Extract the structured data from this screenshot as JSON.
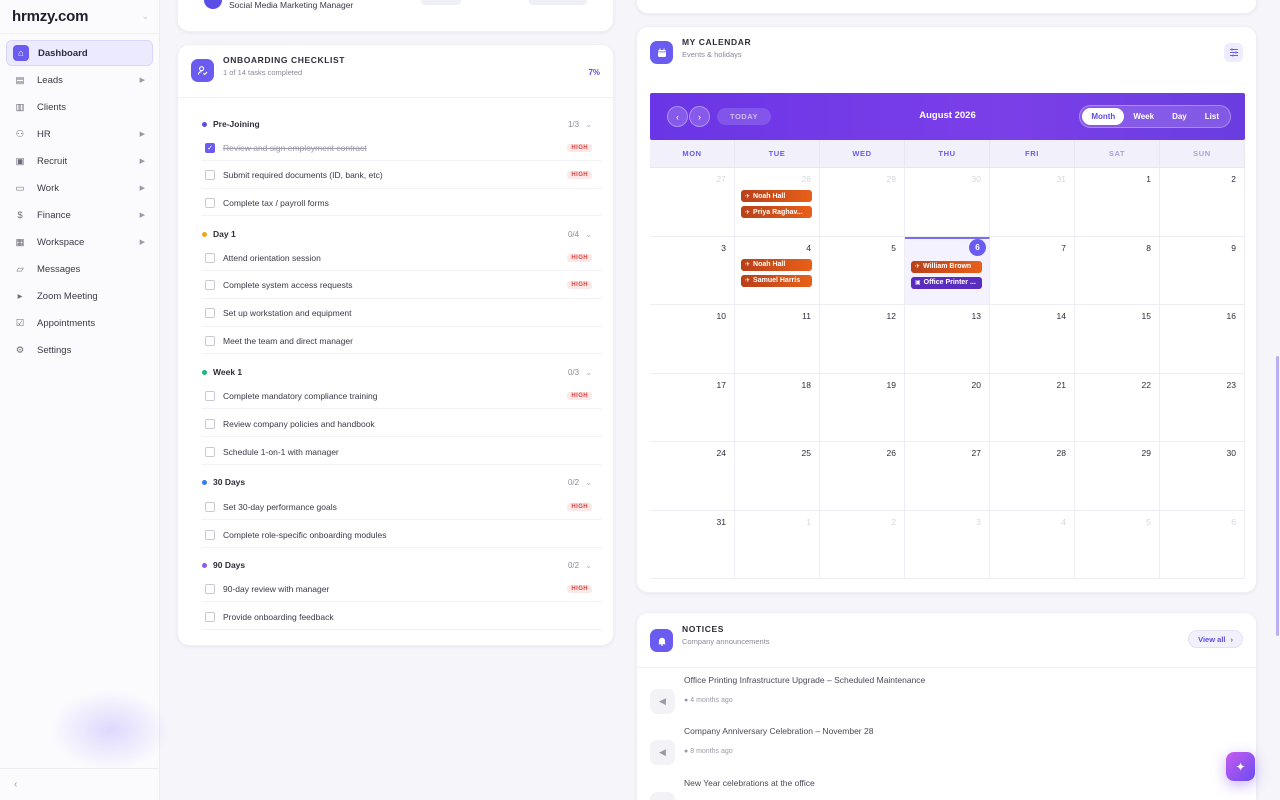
{
  "brand": {
    "logo": "hrmzy.com",
    "dot": "."
  },
  "sidebar": {
    "items": [
      {
        "label": "Dashboard",
        "icon": "home-icon",
        "active": true,
        "arrow": false
      },
      {
        "label": "Leads",
        "icon": "contact-card-icon",
        "arrow": true
      },
      {
        "label": "Clients",
        "icon": "chart-icon",
        "arrow": false
      },
      {
        "label": "HR",
        "icon": "users-icon",
        "arrow": true
      },
      {
        "label": "Recruit",
        "icon": "id-badge-icon",
        "arrow": true
      },
      {
        "label": "Work",
        "icon": "briefcase-icon",
        "arrow": true
      },
      {
        "label": "Finance",
        "icon": "dollar-icon",
        "arrow": true
      },
      {
        "label": "Workspace",
        "icon": "grid-icon",
        "arrow": true
      },
      {
        "label": "Messages",
        "icon": "message-icon",
        "arrow": false
      },
      {
        "label": "Zoom Meeting",
        "icon": "video-icon",
        "arrow": false
      },
      {
        "label": "Appointments",
        "icon": "calendar-check-icon",
        "arrow": false
      },
      {
        "label": "Settings",
        "icon": "gear-icon",
        "arrow": false
      }
    ],
    "collapse_glyph": "‹"
  },
  "top_card": {
    "role": "Social Media Marketing Manager"
  },
  "onboarding": {
    "title": "ONBOARDING CHECKLIST",
    "subtitle": "1 of 14 tasks completed",
    "percent": "7%",
    "sections": [
      {
        "name": "Pre-Joining",
        "count": "1/3",
        "color": "#5b4de8",
        "tasks": [
          {
            "label": "Review and sign employment contract",
            "done": true,
            "high": true
          },
          {
            "label": "Submit required documents (ID, bank, etc)",
            "done": false,
            "high": true
          },
          {
            "label": "Complete tax / payroll forms",
            "done": false,
            "high": false
          }
        ]
      },
      {
        "name": "Day 1",
        "count": "0/4",
        "color": "#f0a41a",
        "tasks": [
          {
            "label": "Attend orientation session",
            "done": false,
            "high": true
          },
          {
            "label": "Complete system access requests",
            "done": false,
            "high": true
          },
          {
            "label": "Set up workstation and equipment",
            "done": false,
            "high": false
          },
          {
            "label": "Meet the team and direct manager",
            "done": false,
            "high": false
          }
        ]
      },
      {
        "name": "Week 1",
        "count": "0/3",
        "color": "#1ab87a",
        "tasks": [
          {
            "label": "Complete mandatory compliance training",
            "done": false,
            "high": true
          },
          {
            "label": "Review company policies and handbook",
            "done": false,
            "high": false
          },
          {
            "label": "Schedule 1-on-1 with manager",
            "done": false,
            "high": false
          }
        ]
      },
      {
        "name": "30 Days",
        "count": "0/2",
        "color": "#3a7af0",
        "tasks": [
          {
            "label": "Set 30-day performance goals",
            "done": false,
            "high": true
          },
          {
            "label": "Complete role-specific onboarding modules",
            "done": false,
            "high": false
          }
        ]
      },
      {
        "name": "90 Days",
        "count": "0/2",
        "color": "#8a5cf0",
        "tasks": [
          {
            "label": "90-day review with manager",
            "done": false,
            "high": true
          },
          {
            "label": "Provide onboarding feedback",
            "done": false,
            "high": false
          }
        ]
      }
    ],
    "high_label": "HIGH"
  },
  "calendar": {
    "title": "MY CALENDAR",
    "subtitle": "Events & holidays",
    "month": "August 2026",
    "today_label": "TODAY",
    "views": [
      "Month",
      "Week",
      "Day",
      "List"
    ],
    "active_view": "Month",
    "dow": [
      "MON",
      "TUE",
      "WED",
      "THU",
      "FRI",
      "SAT",
      "SUN"
    ],
    "weeks": [
      [
        {
          "n": "27",
          "m": true
        },
        {
          "n": "28",
          "m": true
        },
        {
          "n": "29",
          "m": true
        },
        {
          "n": "30",
          "m": true
        },
        {
          "n": "31",
          "m": true
        },
        {
          "n": "1"
        },
        {
          "n": "2"
        }
      ],
      [
        {
          "n": "3"
        },
        {
          "n": "4"
        },
        {
          "n": "5"
        },
        {
          "n": "6",
          "today": true
        },
        {
          "n": "7"
        },
        {
          "n": "8"
        },
        {
          "n": "9"
        }
      ],
      [
        {
          "n": "10"
        },
        {
          "n": "11"
        },
        {
          "n": "12"
        },
        {
          "n": "13"
        },
        {
          "n": "14"
        },
        {
          "n": "15"
        },
        {
          "n": "16"
        }
      ],
      [
        {
          "n": "17"
        },
        {
          "n": "18"
        },
        {
          "n": "19"
        },
        {
          "n": "20"
        },
        {
          "n": "21"
        },
        {
          "n": "22"
        },
        {
          "n": "23"
        }
      ],
      [
        {
          "n": "24"
        },
        {
          "n": "25"
        },
        {
          "n": "26"
        },
        {
          "n": "27"
        },
        {
          "n": "28"
        },
        {
          "n": "29"
        },
        {
          "n": "30"
        }
      ],
      [
        {
          "n": "31"
        },
        {
          "n": "1",
          "m": true
        },
        {
          "n": "2",
          "m": true
        },
        {
          "n": "3",
          "m": true
        },
        {
          "n": "4",
          "m": true
        },
        {
          "n": "5",
          "m": true
        },
        {
          "n": "6",
          "m": true
        }
      ]
    ],
    "events": [
      {
        "week": 0,
        "day": 1,
        "slot": 0,
        "label": "Noah Hall",
        "kind": "orange",
        "icon": "✈"
      },
      {
        "week": 0,
        "day": 1,
        "slot": 1,
        "label": "Priya Raghav...",
        "kind": "orange",
        "icon": "✈"
      },
      {
        "week": 1,
        "day": 1,
        "slot": 0,
        "label": "Noah Hall",
        "kind": "orange",
        "icon": "✈"
      },
      {
        "week": 1,
        "day": 1,
        "slot": 1,
        "label": "Samuel Harris",
        "kind": "orange",
        "icon": "✈"
      },
      {
        "week": 1,
        "day": 3,
        "slot": 0,
        "label": "William Brown",
        "kind": "orange",
        "icon": "✈"
      },
      {
        "week": 1,
        "day": 3,
        "slot": 1,
        "label": "Office Printer ...",
        "kind": "purple",
        "icon": "▣"
      }
    ]
  },
  "notices": {
    "title": "NOTICES",
    "subtitle": "Company announcements",
    "view_all": "View all",
    "items": [
      {
        "title": "Office Printing Infrastructure Upgrade – Scheduled Maintenance",
        "time": "4 months ago"
      },
      {
        "title": "Company Anniversary Celebration – November 28",
        "time": "8 months ago"
      },
      {
        "title": "New Year celebrations at the office",
        "time": ""
      }
    ]
  },
  "colors": {
    "accent": "#6a5cf0",
    "high": "#d9433f"
  }
}
